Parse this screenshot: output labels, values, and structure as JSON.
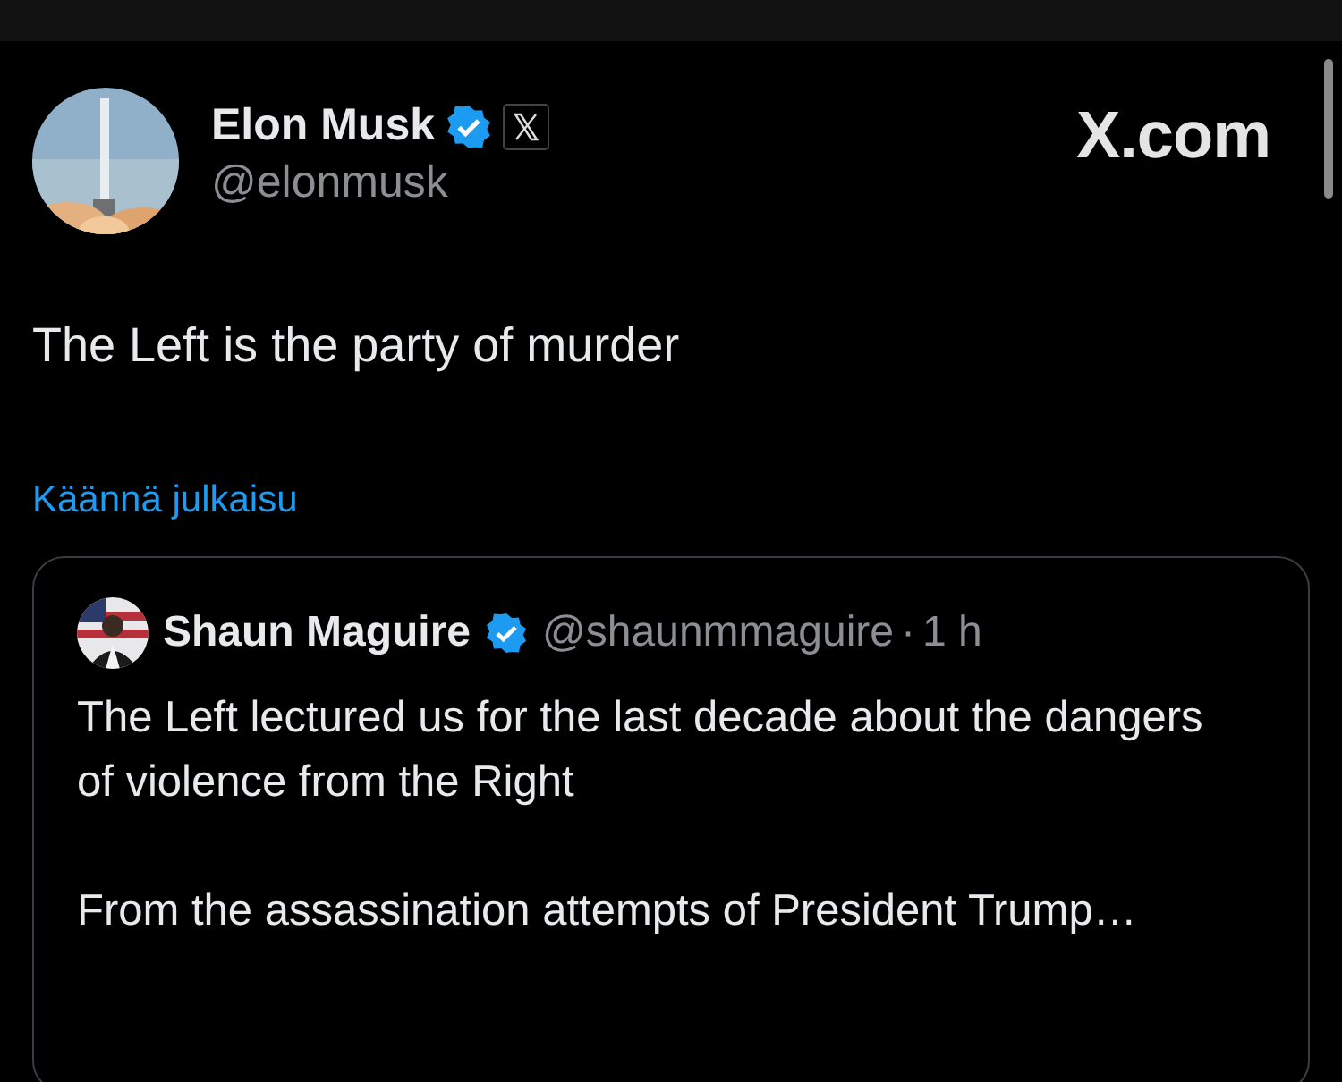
{
  "post": {
    "author": {
      "name": "Elon Musk",
      "handle": "@elonmusk",
      "verified": true,
      "affiliate_badge": true
    },
    "site": "X.com",
    "text": "The Left is the party of murder",
    "translate_link": "Käännä julkaisu",
    "quote": {
      "author": {
        "name": "Shaun Maguire",
        "handle": "@shaunmmaguire",
        "verified": true
      },
      "separator": "·",
      "time": "1 h",
      "paragraphs": [
        "The Left lectured us for the last decade about the dangers of violence from the Right",
        "From the assassination attempts of President Trump…"
      ]
    }
  }
}
